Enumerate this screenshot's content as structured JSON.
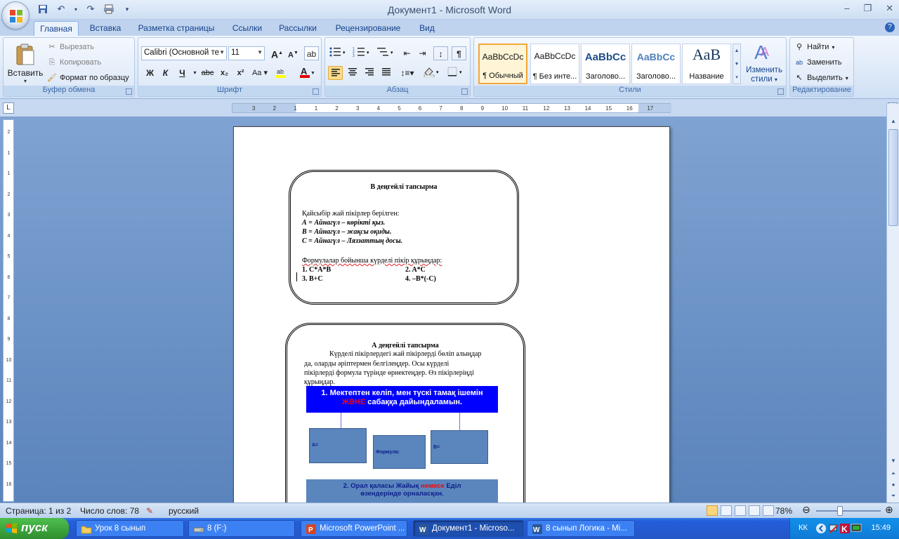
{
  "window": {
    "title": "Документ1 - Microsoft Word"
  },
  "ribbon_tabs": [
    "Главная",
    "Вставка",
    "Разметка страницы",
    "Ссылки",
    "Рассылки",
    "Рецензирование",
    "Вид"
  ],
  "clipboard": {
    "paste": "Вставить",
    "cut": "Вырезать",
    "copy": "Копировать",
    "format_painter": "Формат по образцу",
    "group_label": "Буфер обмена"
  },
  "font": {
    "font_name": "Calibri (Основной те",
    "font_size": "11",
    "group_label": "Шрифт",
    "bold": "Ж",
    "italic": "К",
    "underline": "Ч",
    "strike": "abc",
    "subscript": "x₂",
    "superscript": "x²",
    "change_case": "Aa",
    "grow": "A",
    "shrink": "A",
    "font_color": "A"
  },
  "paragraph": {
    "group_label": "Абзац",
    "pilcrow": "¶"
  },
  "styles": {
    "group_label": "Стили",
    "items": [
      {
        "sample": "AaBbCcDc",
        "name": "¶ Обычный"
      },
      {
        "sample": "AaBbCcDc",
        "name": "¶ Без инте..."
      },
      {
        "sample": "AaBbCc",
        "name": "Заголово..."
      },
      {
        "sample": "AaBbCc",
        "name": "Заголово..."
      },
      {
        "sample": "АаВ",
        "name": "Название"
      }
    ],
    "change_styles_line1": "Изменить",
    "change_styles_line2": "стили"
  },
  "editing": {
    "group_label": "Редактирование",
    "find": "Найти",
    "replace": "Заменить",
    "select": "Выделить"
  },
  "ruler": {
    "numbers": [
      "3",
      "2",
      "1",
      "1",
      "2",
      "3",
      "4",
      "5",
      "6",
      "7",
      "8",
      "9",
      "10",
      "11",
      "12",
      "13",
      "14",
      "15",
      "16",
      "17"
    ],
    "vnumbers": [
      "2",
      "1",
      "1",
      "2",
      "3",
      "4",
      "5",
      "6",
      "7",
      "8",
      "9",
      "10",
      "11",
      "12",
      "13",
      "14",
      "15",
      "16"
    ]
  },
  "document": {
    "card1": {
      "title": "В деңгейлі тапсырма",
      "intro": "Қайсыбір жай пікірлер берілген:",
      "a": "А = Айнагүл – көрікті қыз.",
      "b": "В = Айнагүл – жақсы оқиды.",
      "c": "С = Айнагүл – Ляззаттың досы.",
      "task": "Формулалар бойынша күрделі пікір құрыңдар:",
      "f1": "1. C*A*B",
      "f2": "2. A*C",
      "f3": "3. B+C",
      "f4": "4. –B*(-C)"
    },
    "card2": {
      "title": "А деңгейлі тапсырма",
      "p1": "Күрделі пікірлердегі жай пікірлерді бөліп алыңдар",
      "p2": "да, оларды әріптермен белгілеңдер. Осы күрделі",
      "p3": "пікірлерді формула түрінде өрнектеңдер. Өз пікірлеріңді",
      "p4": "құрыңдар.",
      "bar1_line1": "1. Мектептен келіп, мен түскі тамақ ішемін",
      "bar1_and": "ЖӘНЕ",
      "bar1_line2": " сабаққа дайындаламын.",
      "box_a": "А=",
      "box_formula": "Формула:",
      "box_b": "В=",
      "bar2_pre": "2. Орал қаласы Жайық ",
      "bar2_or": "немесе",
      "bar2_post": " Еділ",
      "bar2_line2": "өзендерінде орналасқан."
    }
  },
  "status": {
    "page": "Страница: 1 из 2",
    "words": "Число слов: 78",
    "language": "русский",
    "zoom": "78%"
  },
  "taskbar": {
    "start": "пуск",
    "tasks": [
      "Урок 8 сынып",
      "8 (F:)",
      "Microsoft PowerPoint ...",
      "Документ1 - Microso...",
      "8 сынып Логика - Mi..."
    ],
    "lang": "КК",
    "clock": "15:49"
  },
  "colors": {
    "blue_bar": "#0000ff",
    "steel_box": "#5b85bd",
    "red_text": "#ff0000",
    "accent": "#15428b"
  }
}
